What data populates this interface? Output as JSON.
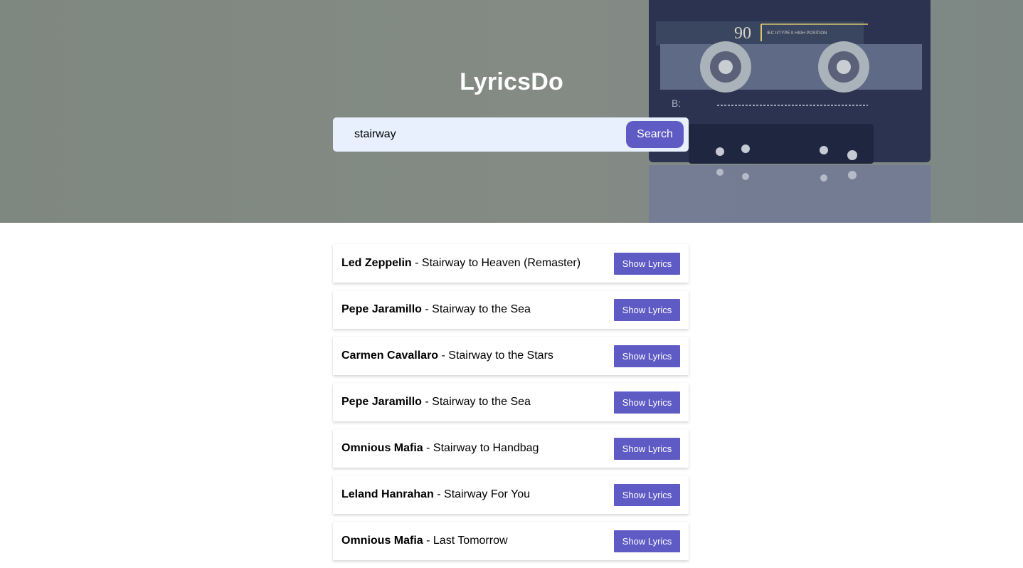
{
  "app": {
    "title": "LyricsDo"
  },
  "search": {
    "value": "stairway",
    "button_label": "Search"
  },
  "results": [
    {
      "artist": "Led Zeppelin",
      "separator": " - ",
      "song": "Stairway to Heaven (Remaster)",
      "button_label": "Show Lyrics"
    },
    {
      "artist": "Pepe Jaramillo",
      "separator": " - ",
      "song": "Stairway to the Sea",
      "button_label": "Show Lyrics"
    },
    {
      "artist": "Carmen Cavallaro",
      "separator": " - ",
      "song": "Stairway to the Stars",
      "button_label": "Show Lyrics"
    },
    {
      "artist": "Pepe Jaramillo",
      "separator": " - ",
      "song": "Stairway to the Sea",
      "button_label": "Show Lyrics"
    },
    {
      "artist": "Omnious Mafia",
      "separator": " - ",
      "song": "Stairway to Handbag",
      "button_label": "Show Lyrics"
    },
    {
      "artist": "Leland Hanrahan",
      "separator": " - ",
      "song": "Stairway For You",
      "button_label": "Show Lyrics"
    },
    {
      "artist": "Omnious Mafia",
      "separator": " - ",
      "song": "Last Tomorrow",
      "button_label": "Show Lyrics"
    }
  ],
  "hero": {
    "background_image": "cassette-tape-photo",
    "cassette_label_number": "90",
    "cassette_label_text": "IEC II/TYPE II HIGH POSITION",
    "cassette_side": "B:"
  },
  "colors": {
    "accent": "#5f5bc5",
    "input_bg": "#e8f0fe",
    "hero_bg": "#818983"
  }
}
